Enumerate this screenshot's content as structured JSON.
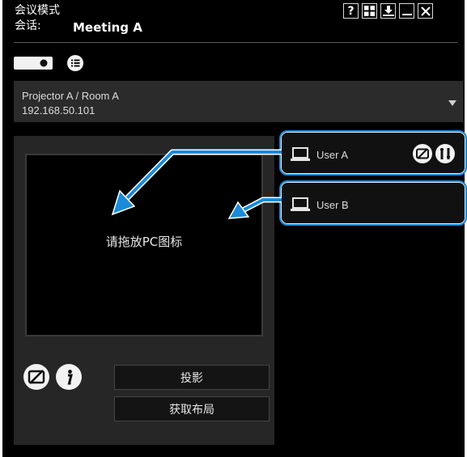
{
  "header": {
    "mode_label": "会议模式",
    "session_label": "会话:",
    "session_name": "Meeting A"
  },
  "toolbar": {
    "help_label": "?"
  },
  "projector": {
    "name": "Projector A / Room A",
    "ip": "192.168.50.101"
  },
  "drop_area": {
    "hint": "请拖放PC图标"
  },
  "buttons": {
    "project_label": "投影",
    "get_layout_label": "获取布局"
  },
  "users": [
    {
      "name": "User A"
    },
    {
      "name": "User B"
    }
  ],
  "colors": {
    "window_bg": "#000000",
    "highlight_border": "#1a8bd8",
    "arrow_fill": "#1a8bd8"
  }
}
